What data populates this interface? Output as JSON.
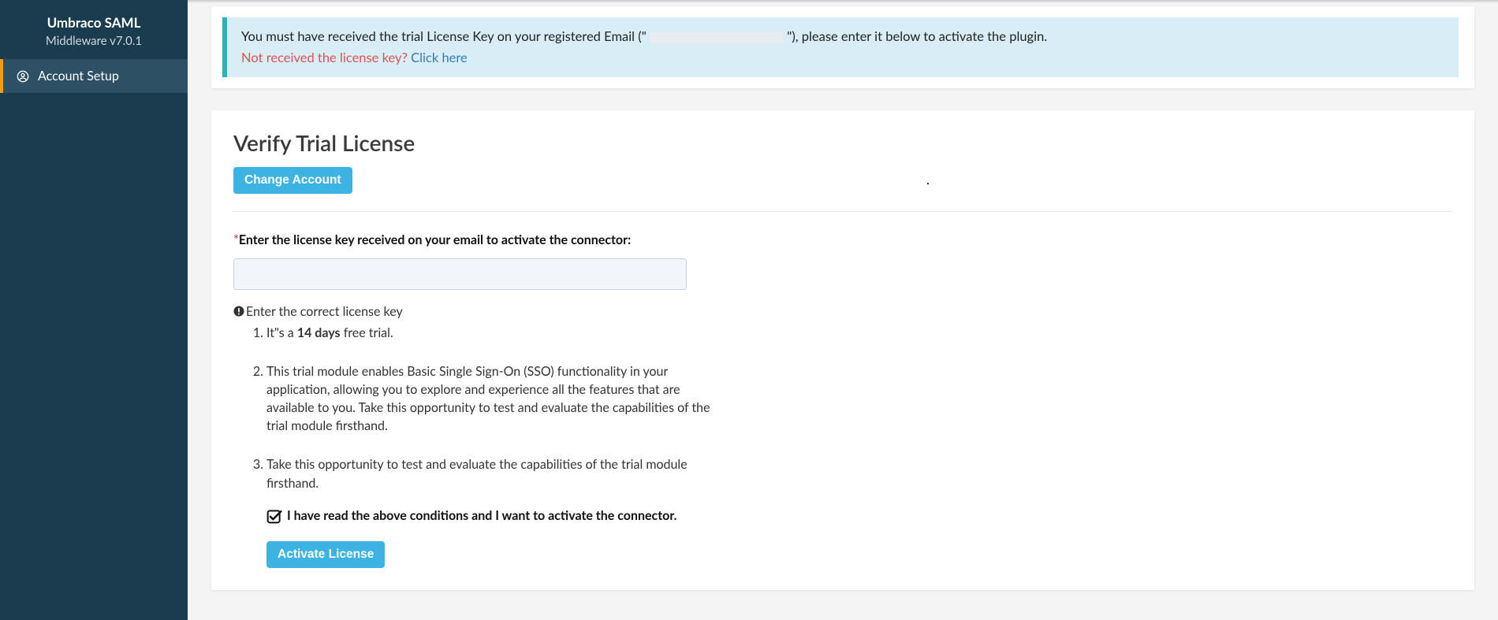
{
  "sidebar": {
    "brand_title": "Umbraco SAML",
    "brand_sub": "Middleware v7.0.1",
    "items": [
      {
        "label": "Account Setup",
        "icon": "user-circle-icon"
      }
    ]
  },
  "alert": {
    "prefix": "You must have received the trial License Key on your registered Email (\"",
    "suffix": "\"), please enter it below to activate the plugin.",
    "not_received": "Not received the license key? ",
    "click_here": "Click here"
  },
  "panel": {
    "title": "Verify Trial License",
    "change_account_btn": "Change Account",
    "field_label": "Enter the license key received on your email to activate the connector:",
    "license_value": "",
    "warn_text": "Enter the correct license key",
    "conditions": {
      "c1_pre": "It\"s a ",
      "c1_bold": "14 days",
      "c1_post": " free trial.",
      "c2": "This trial module enables Basic Single Sign-On (SSO) functionality in your application, allowing you to explore and experience all the features that are available to you. Take this opportunity to test and evaluate the capabilities of the trial module firsthand.",
      "c3": "Take this opportunity to test and evaluate the capabilities of the trial module firsthand."
    },
    "accept_label": "I have read the above conditions and I want to activate the connector.",
    "accept_checked": true,
    "activate_btn": "Activate License"
  }
}
